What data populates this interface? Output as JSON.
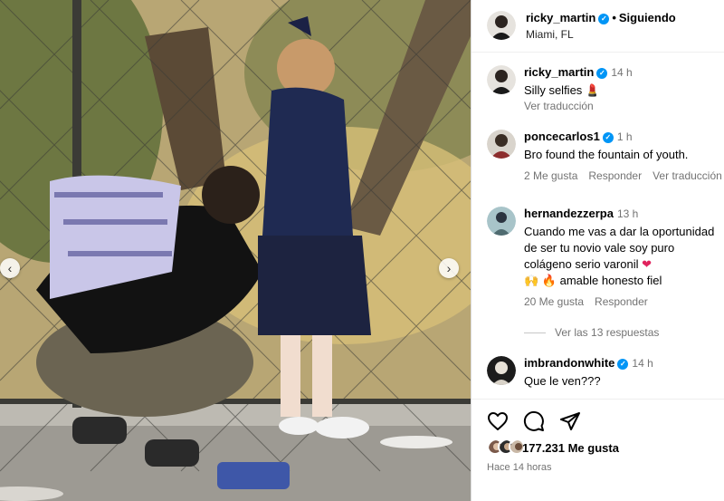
{
  "post": {
    "author": "ricky_martin",
    "dot": "•",
    "following_label": "Siguiendo",
    "location": "Miami, FL"
  },
  "caption": {
    "user": "ricky_martin",
    "time": "14 h",
    "text": "Silly selfies",
    "emoji": "💄",
    "translate": "Ver traducción"
  },
  "comments": [
    {
      "user": "poncecarlos1",
      "time": "1 h",
      "text": "Bro found the fountain of youth.",
      "likes": "2 Me gusta",
      "reply": "Responder",
      "translate": "Ver traducción"
    },
    {
      "user": "hernandezzerpa",
      "time": "13 h",
      "text": "Cuando me vas a dar la oportunidad de ser tu novio vale soy puro colágeno serio varonil",
      "emoji1": "❤",
      "emoji2": "🙌",
      "emoji3": "🔥",
      "text2": "amable honesto fiel",
      "likes": "20 Me gusta",
      "reply": "Responder"
    },
    {
      "user": "imbrandonwhite",
      "time": "14 h",
      "text": "Que le ven???"
    }
  ],
  "view_replies": "Ver las 13 respuestas",
  "actions": {
    "like_icon": "heart-outline-icon",
    "comment_icon": "comment-bubble-icon",
    "share_icon": "paper-plane-icon",
    "likes_count": "177.231 Me gusta",
    "posted": "Hace 14 horas"
  },
  "nav": {
    "prev": "‹",
    "next": "›"
  },
  "colors": {
    "verified": "#0095f6",
    "muted": "#737373"
  }
}
